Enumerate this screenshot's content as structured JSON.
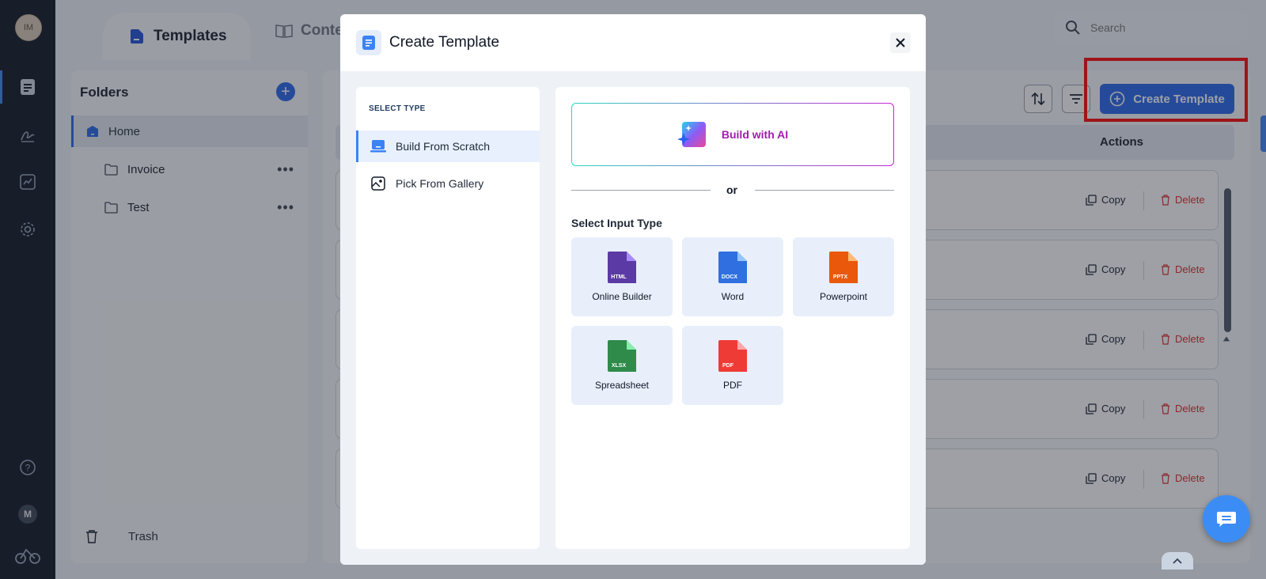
{
  "sidebar": {
    "avatar_initials": "IM",
    "user_initial": "M",
    "icons": [
      "document-icon",
      "signature-icon",
      "analytics-icon",
      "settings-icon",
      "help-icon",
      "logo-icon"
    ]
  },
  "header": {
    "tabs": [
      {
        "label": "Templates",
        "active": true
      },
      {
        "label": "Conte"
      }
    ],
    "search_placeholder": "Search"
  },
  "folders": {
    "title": "Folders",
    "items": [
      {
        "label": "Home",
        "active": true
      },
      {
        "label": "Invoice"
      },
      {
        "label": "Test"
      }
    ],
    "trash_label": "Trash"
  },
  "main": {
    "create_button_label": "Create Template",
    "actions_header": "Actions",
    "rows": [
      {
        "copy": "Copy",
        "delete": "Delete"
      },
      {
        "copy": "Copy",
        "delete": "Delete"
      },
      {
        "copy": "Copy",
        "delete": "Delete"
      },
      {
        "copy": "Copy",
        "delete": "Delete"
      },
      {
        "copy": "Copy",
        "delete": "Delete"
      }
    ]
  },
  "modal": {
    "title": "Create Template",
    "select_type_heading": "SELECT TYPE",
    "types": [
      {
        "label": "Build From Scratch",
        "active": true
      },
      {
        "label": "Pick From Gallery"
      }
    ],
    "ai_button_label": "Build with AI",
    "or_text": "or",
    "input_type_heading": "Select Input Type",
    "input_types": [
      {
        "label": "Online Builder",
        "badge": "HTML",
        "color": "#5b3aa6"
      },
      {
        "label": "Word",
        "badge": "DOCX",
        "color": "#2f6fe0"
      },
      {
        "label": "Powerpoint",
        "badge": "PPTX",
        "color": "#ea580c"
      },
      {
        "label": "Spreadsheet",
        "badge": "XLSX",
        "color": "#2e8b4a"
      },
      {
        "label": "PDF",
        "badge": "PDF",
        "color": "#ef3b36"
      }
    ]
  },
  "colors": {
    "accent": "#2563eb",
    "highlight": "#ff0000",
    "delete": "#dc2626",
    "ai_gradient_start": "#2dd4bf",
    "ai_gradient_end": "#c026d3"
  }
}
